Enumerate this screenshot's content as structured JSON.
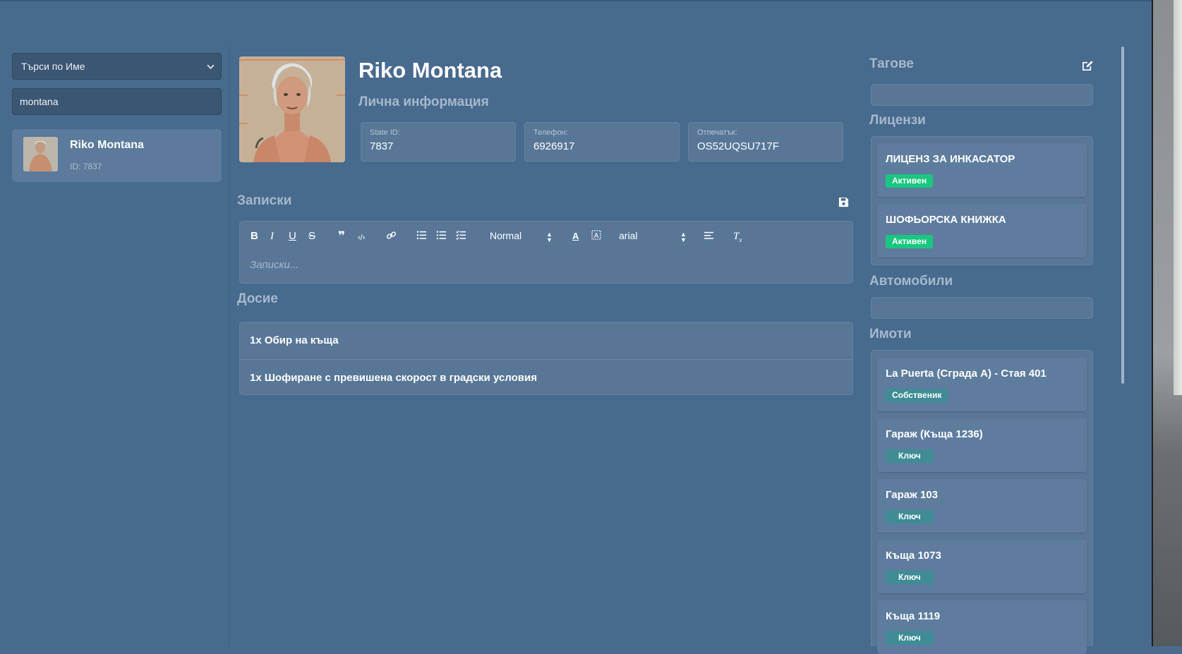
{
  "search": {
    "mode_label": "Търси по Име",
    "query": "montana"
  },
  "results": [
    {
      "name": "Riko Montana",
      "id_label": "ID:",
      "id": "7837"
    }
  ],
  "profile": {
    "name": "Riko Montana",
    "section_title": "Лична информация",
    "fields": [
      {
        "label": "State ID:",
        "value": "7837"
      },
      {
        "label": "Телефон:",
        "value": "6926917"
      },
      {
        "label": "Отпечатък:",
        "value": "OS52UQSU717F"
      }
    ]
  },
  "notes": {
    "title": "Записки",
    "placeholder": "Записки...",
    "toolbar": {
      "bold": "B",
      "italic": "I",
      "underline": "U",
      "strike": "S",
      "quote": "❞",
      "code": "‹/›",
      "link": "🔗",
      "header_select": "Normal",
      "font_select": "arial",
      "text_color": "A",
      "clear_format": "T"
    }
  },
  "record": {
    "title": "Досие",
    "items": [
      "1x Обир на къща",
      "1x Шофиране с превишена скорост в градски условия"
    ]
  },
  "tags": {
    "title": "Тагове"
  },
  "licenses": {
    "title": "Лицензи",
    "items": [
      {
        "name": "ЛИЦЕНЗ ЗА ИНКАСАТОР",
        "status": "Активен"
      },
      {
        "name": "ШОФЬОРСКА КНИЖКА",
        "status": "Активен"
      }
    ]
  },
  "vehicles": {
    "title": "Автомобили"
  },
  "properties": {
    "title": "Имоти",
    "items": [
      {
        "name": "La Puerta (Сграда A) - Стая 401",
        "role": "Собственик"
      },
      {
        "name": "Гараж (Къща 1236)",
        "role": "Ключ"
      },
      {
        "name": "Гараж 103",
        "role": "Ключ"
      },
      {
        "name": "Къща 1073",
        "role": "Ключ"
      },
      {
        "name": "Къща 1119",
        "role": "Ключ"
      }
    ]
  },
  "colors": {
    "background": "#486a8e",
    "panel": "#587797",
    "active_badge": "#19c77f",
    "key_badge": "#3f8c95"
  }
}
